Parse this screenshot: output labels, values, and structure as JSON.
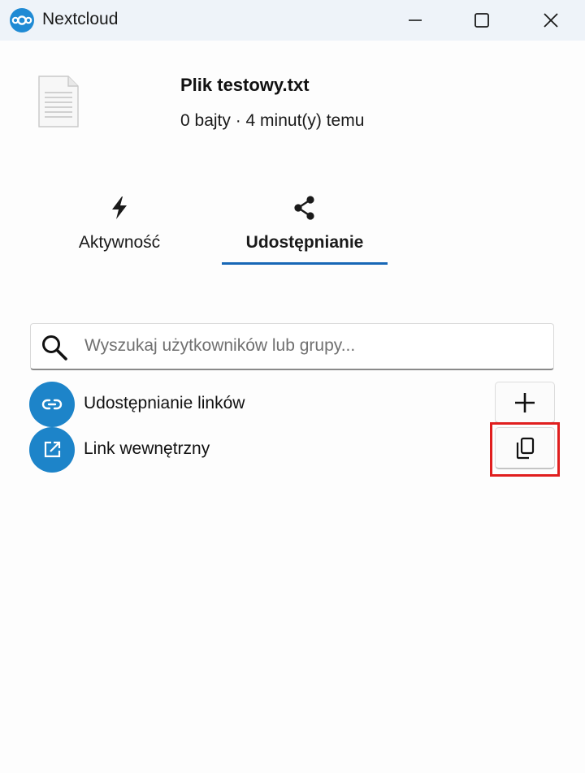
{
  "window": {
    "title": "Nextcloud",
    "accent_color": "#1f8ad4"
  },
  "file": {
    "name": "Plik testowy.txt",
    "meta": "0 bajty · 4 minut(y) temu"
  },
  "tabs": [
    {
      "label": "Aktywność",
      "icon": "lightning-icon",
      "active": false
    },
    {
      "label": "Udostępnianie",
      "icon": "share-icon",
      "active": true
    }
  ],
  "search": {
    "placeholder": "Wyszukaj użytkowników lub grupy...",
    "value": ""
  },
  "shares": [
    {
      "label": "Udostępnianie linków",
      "icon": "link-icon",
      "action_icon": "plus-icon"
    },
    {
      "label": "Link wewnętrzny",
      "icon": "external-link-icon",
      "action_icon": "copy-icon"
    }
  ],
  "colors": {
    "tab_underline": "#1767b6",
    "avatar": "#1d84c9",
    "highlight": "#e01e1e"
  }
}
